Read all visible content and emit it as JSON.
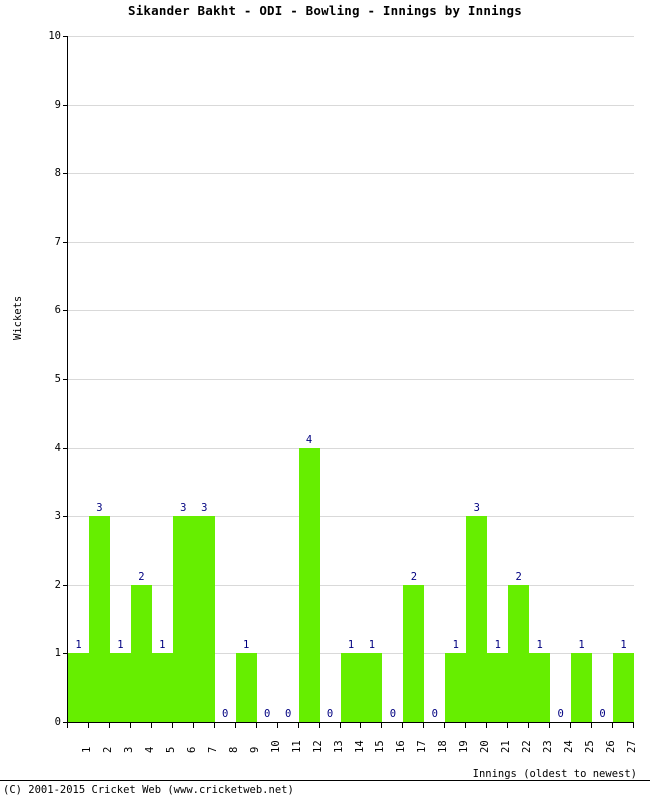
{
  "chart_data": {
    "type": "bar",
    "title": "Sikander Bakht - ODI - Bowling - Innings by Innings",
    "xlabel": "Innings (oldest to newest)",
    "ylabel": "Wickets",
    "categories": [
      "1",
      "2",
      "3",
      "4",
      "5",
      "6",
      "7",
      "8",
      "9",
      "10",
      "11",
      "12",
      "13",
      "14",
      "15",
      "16",
      "17",
      "18",
      "19",
      "20",
      "21",
      "22",
      "23",
      "24",
      "25",
      "26",
      "27"
    ],
    "values": [
      1,
      3,
      1,
      2,
      1,
      3,
      3,
      0,
      1,
      0,
      0,
      4,
      0,
      1,
      1,
      0,
      2,
      0,
      1,
      3,
      1,
      2,
      1,
      0,
      1,
      0,
      1
    ],
    "data_labels": [
      "1",
      "3",
      "1",
      "2",
      "1",
      "3",
      "3",
      "0",
      "1",
      "0",
      "0",
      "4",
      "0",
      "1",
      "1",
      "0",
      "2",
      "0",
      "1",
      "3",
      "1",
      "2",
      "1",
      "0",
      "1",
      "0",
      "1"
    ],
    "ylim": [
      0,
      10
    ],
    "ytick_labels": [
      "0",
      "1",
      "2",
      "3",
      "4",
      "5",
      "6",
      "7",
      "8",
      "9",
      "10"
    ],
    "ytick_values": [
      0,
      1,
      2,
      3,
      4,
      5,
      6,
      7,
      8,
      9,
      10
    ],
    "grid": true,
    "legend": "none",
    "bar_color": "#66ee00",
    "label_color": "#000080",
    "grid_color": "#d9d9d9",
    "axis_color": "#000000"
  },
  "footer": {
    "copyright": "(C) 2001-2015 Cricket Web (www.cricketweb.net)"
  }
}
